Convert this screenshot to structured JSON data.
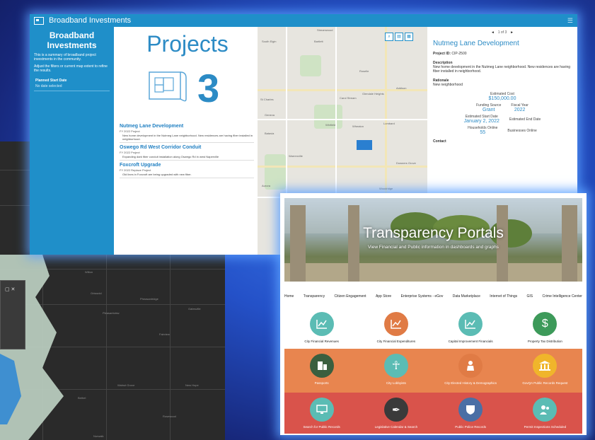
{
  "dashboard": {
    "window_title": "Broadband Investments",
    "sidebar": {
      "title": "Broadband Investments",
      "summary": "This is a summary of broadband project investments in the community.",
      "hint": "Adjust the filters or current map extent to refine the results.",
      "filter_label": "Planned Start Date",
      "filter_value": "No date selected"
    },
    "projects": {
      "title": "Projects",
      "count": "3",
      "items": [
        {
          "title": "Nutmeg Lane Development",
          "sub": "FY 2022 Project",
          "desc": "New home development in the Nutmeg Lane neighborhood. New residences are having fiber installed in neighborhood."
        },
        {
          "title": "Oswego Rd West Corridor Conduit",
          "sub": "FY 2022 Project",
          "desc": "Expanding dark fiber conduit installation along Oswego Rd in west Naperville"
        },
        {
          "title": "Foxcroft Upgrade",
          "sub": "FY 2022 Replace Project",
          "desc": "Old lines in Foxcroft are being upgraded with new fiber."
        }
      ]
    },
    "map_labels": [
      "Streamwood",
      "South Elgin",
      "Bartlett",
      "Roselle",
      "Addison",
      "Carol Stream",
      "Glendale Heights",
      "St Charles",
      "Geneva",
      "Winfield",
      "Wheaton",
      "Lombard",
      "Batavia",
      "Naperville",
      "Downers Grove",
      "Aurora",
      "Woodridge",
      "Warrenville"
    ],
    "detail": {
      "pager": "1 of 3",
      "title": "Nutmeg Lane Development",
      "project_id_label": "Project ID:",
      "project_id": "CIP-2500",
      "description_label": "Description",
      "description": "New home development in the Nutmeg Lane neighborhood. New residences are having fiber installed in neighborhood.",
      "rationale_label": "Rationale",
      "rationale": "New neighborhood",
      "cost_label": "Estimated Cost",
      "cost": "$150,000.00",
      "funding_label": "Funding Source",
      "funding": "Grant",
      "fy_label": "Fiscal Year",
      "fy": "2022",
      "start_label": "Estimated Start Date",
      "start": "January 2, 2022",
      "end_label": "Estimated End Date",
      "households_label": "Households Online",
      "households": "55",
      "businesses_label": "Businesses Online",
      "contact_label": "Contact"
    }
  },
  "portal": {
    "title": "Transparency Portals",
    "subtitle": "View Financial and Public information in dashboards and graphs",
    "nav": [
      "Home",
      "Transparency",
      "Citizen Engagement",
      "App Store",
      "Enterprise Systems - eGov",
      "Data Marketplace",
      "Internet of Things",
      "GIS",
      "Crime Intelligence Center"
    ],
    "row1": [
      {
        "label": "City Financial Revenues",
        "icon": "chart-icon",
        "color": "#5bbcb4"
      },
      {
        "label": "City Financial Expenditures",
        "icon": "chart-icon",
        "color": "#e07b45"
      },
      {
        "label": "Capital Improvement Financials",
        "icon": "chart-icon",
        "color": "#5bbcb4"
      },
      {
        "label": "Property Tax Distribution",
        "icon": "dollar-icon",
        "color": "#3d9a5a"
      }
    ],
    "row2": [
      {
        "label": "Passports",
        "icon": "building-icon",
        "color": "#3a5f3f"
      },
      {
        "label": "City Lobbyists",
        "icon": "person-icon",
        "color": "#5bbcb4"
      },
      {
        "label": "City Elected History & Demographics",
        "icon": "suit-icon",
        "color": "#e07b45"
      },
      {
        "label": "GovQA Public Records Request",
        "icon": "institution-icon",
        "color": "#f0b52b"
      }
    ],
    "row3": [
      {
        "label": "Search for Public Records",
        "icon": "monitor-icon",
        "color": "#5bbcb4"
      },
      {
        "label": "Legislative Calendar & Search",
        "icon": "pen-icon",
        "color": "#3a3a3a"
      },
      {
        "label": "Public Police Records",
        "icon": "shield-icon",
        "color": "#4a6fa5"
      },
      {
        "label": "Permit Inspections Scheduled",
        "icon": "people-icon",
        "color": "#5bbcb4"
      }
    ]
  },
  "background_map": {
    "labels": [
      "Wilton",
      "Griswold",
      "Pheasantridge",
      "Pleasantview",
      "Fairview",
      "Gatesville",
      "Walnut Grove",
      "New Hope",
      "Bethel",
      "Rosewood",
      "Norwalk"
    ]
  }
}
